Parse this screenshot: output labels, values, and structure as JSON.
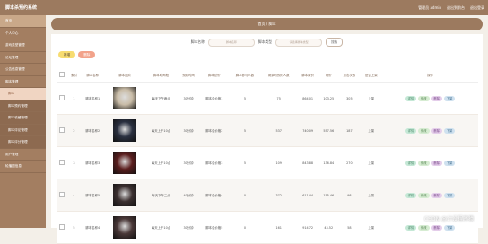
{
  "app": {
    "title": "脚本杀预约系统",
    "nav": [
      "管理员 admin",
      "退出到前台",
      "退出登录"
    ]
  },
  "sidebar": {
    "items": [
      {
        "label": "首页"
      },
      {
        "label": "个人中心"
      },
      {
        "label": "游戏类型管理"
      },
      {
        "label": "论坛管理"
      },
      {
        "label": "公告信息管理"
      },
      {
        "label": "脚本管理"
      },
      {
        "label": "脚本"
      },
      {
        "label": "脚本预约管理"
      },
      {
        "label": "脚本收藏管理"
      },
      {
        "label": "脚本评论管理"
      },
      {
        "label": "脚本评分管理"
      },
      {
        "label": "用户管理"
      },
      {
        "label": "轮播图信息"
      }
    ]
  },
  "breadcrumb": {
    "home": "首页",
    "current": "脚本"
  },
  "search": {
    "field1_label": "脚本名称",
    "field1_placeholder": "脚本名称",
    "field2_label": "脚本类型",
    "field2_placeholder": "请选择脚本类型",
    "search_button": "搜索"
  },
  "toolbar": {
    "add_label": "新增",
    "delete_label": "删除"
  },
  "table": {
    "headers": [
      "",
      "索引",
      "脚本名称",
      "脚本图片",
      "脚本时间段",
      "预约时间",
      "脚本总价",
      "脚本参与人数",
      "剩余可预约人数",
      "脚本原价",
      "现价",
      "点击次数",
      "是否上架",
      "操作"
    ],
    "rows": [
      {
        "index": "1",
        "name": "脚本名称1",
        "time": "每天下午两点",
        "dur": "30分钟",
        "type": "脚本总价格1",
        "people": "5",
        "left": "75",
        "orig": "864.01",
        "price": "103.25",
        "clicks": "305",
        "status": "上架",
        "thumb": "#c9bca7"
      },
      {
        "index": "2",
        "name": "脚本名称2",
        "time": "每天上午10点",
        "dur": "30分钟",
        "type": "脚本总价格2",
        "people": "5",
        "left": "537",
        "orig": "740.09",
        "price": "557.56",
        "clicks": "187",
        "status": "上架",
        "thumb": "#2a3040"
      },
      {
        "index": "3",
        "name": "脚本名称3",
        "time": "每天上午10点",
        "dur": "30分钟",
        "type": "脚本总价格3",
        "people": "5",
        "left": "109",
        "orig": "843.88",
        "price": "136.84",
        "clicks": "270",
        "status": "上架",
        "thumb": "#5b1e1e"
      },
      {
        "index": "4",
        "name": "脚本名称5",
        "time": "每天下午二点",
        "dur": "40分钟",
        "type": "脚本总价格4",
        "people": "0",
        "left": "372",
        "orig": "611.44",
        "price": "155.46",
        "clicks": "98",
        "status": "上架",
        "thumb": "#3c3030"
      },
      {
        "index": "5",
        "name": "脚本名称4",
        "time": "每天上午10点",
        "dur": "30分钟",
        "type": "脚本总价格5",
        "people": "0",
        "left": "161",
        "orig": "914.72",
        "price": "43.52",
        "clicks": "58",
        "status": "上架",
        "thumb": "#4a3838"
      }
    ],
    "ops": {
      "view": "详情",
      "edit": "修改",
      "del": "删除",
      "down": "下架"
    }
  },
  "watermark": "CSDN @计设程序猿"
}
